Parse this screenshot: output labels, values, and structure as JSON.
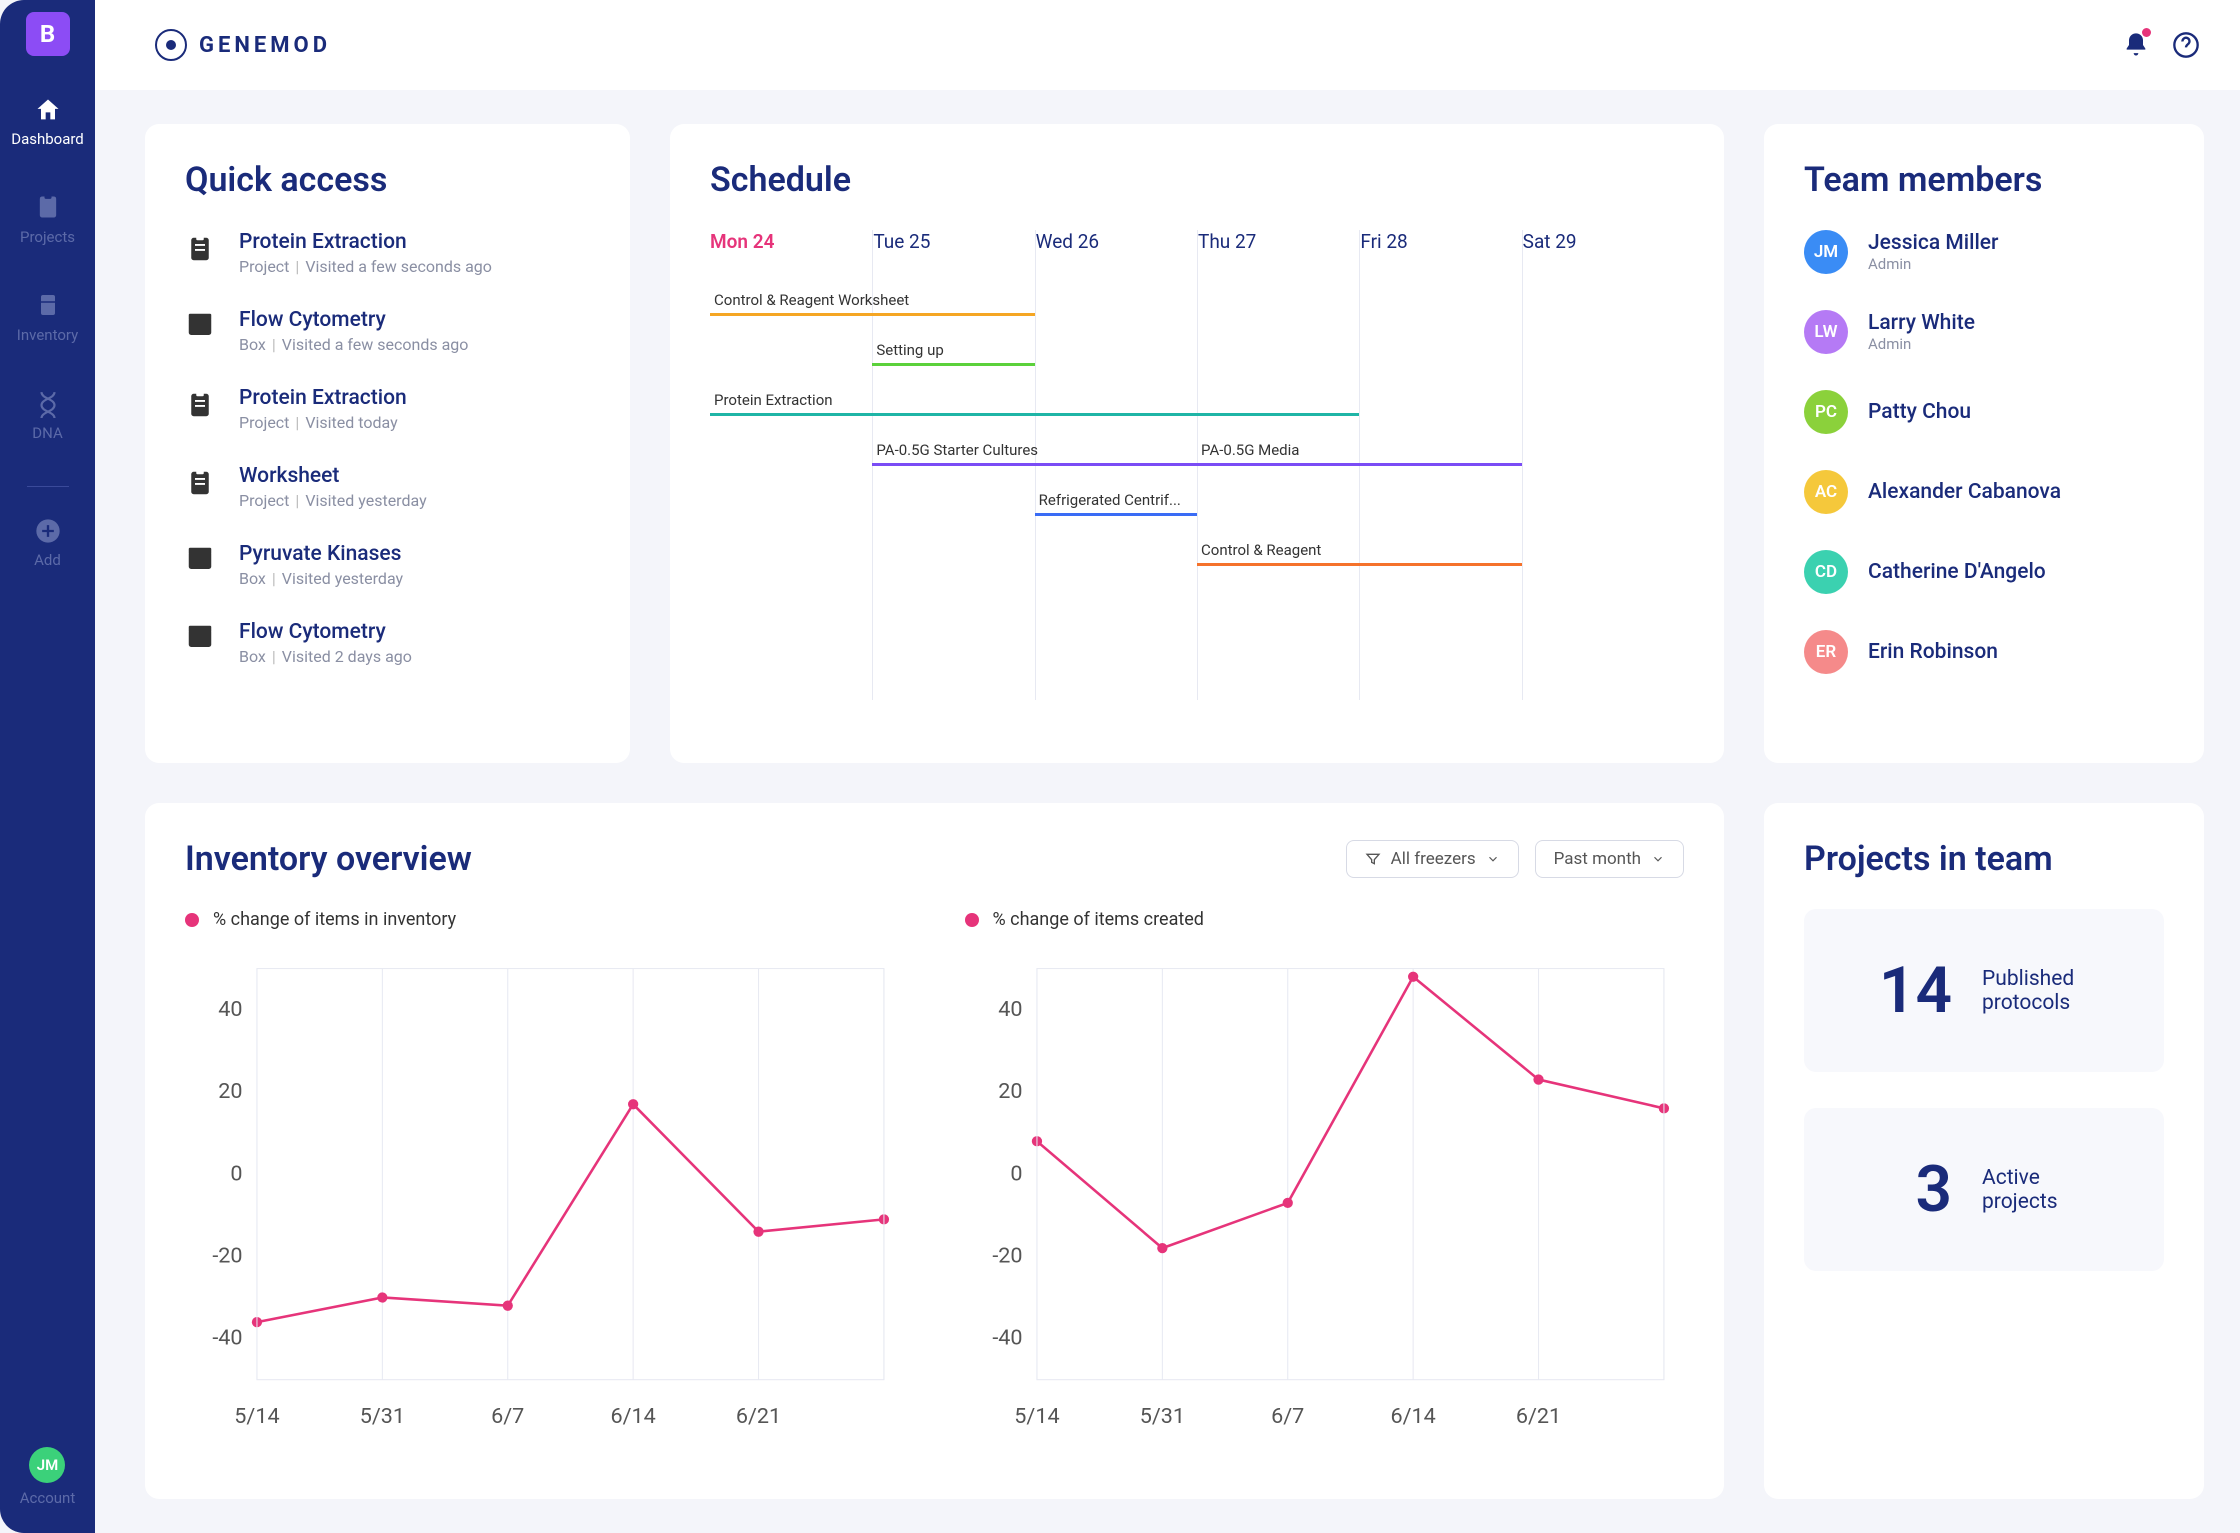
{
  "brand": "GENEMOD",
  "sidebar": {
    "logo": "B",
    "items": [
      {
        "label": "Dashboard",
        "icon": "home"
      },
      {
        "label": "Projects",
        "icon": "clipboard"
      },
      {
        "label": "Inventory",
        "icon": "fridge"
      },
      {
        "label": "DNA",
        "icon": "dna"
      },
      {
        "label": "Add",
        "icon": "plus"
      }
    ],
    "account": {
      "label": "Account",
      "initials": "JM"
    }
  },
  "quick_access": {
    "title": "Quick access",
    "items": [
      {
        "title": "Protein Extraction",
        "type": "Project",
        "visited": "Visited a few seconds ago",
        "icon": "clipboard"
      },
      {
        "title": "Flow Cytometry",
        "type": "Box",
        "visited": "Visited a few seconds ago",
        "icon": "box"
      },
      {
        "title": "Protein Extraction",
        "type": "Project",
        "visited": "Visited today",
        "icon": "clipboard"
      },
      {
        "title": "Worksheet",
        "type": "Project",
        "visited": "Visited yesterday",
        "icon": "clipboard"
      },
      {
        "title": "Pyruvate Kinases",
        "type": "Box",
        "visited": "Visited yesterday",
        "icon": "box"
      },
      {
        "title": "Flow Cytometry",
        "type": "Box",
        "visited": "Visited 2 days ago",
        "icon": "box"
      }
    ]
  },
  "schedule": {
    "title": "Schedule",
    "days": [
      "Mon 24",
      "Tue 25",
      "Wed 26",
      "Thu 27",
      "Fri 28",
      "Sat 29"
    ],
    "active_day_index": 0,
    "bars": [
      {
        "label": "Control & Reagent Worksheet",
        "start": 0,
        "span": 2,
        "color": "#f5a623",
        "row": 0
      },
      {
        "label": "Setting up",
        "start": 1,
        "span": 1,
        "color": "#5bd13b",
        "row": 1
      },
      {
        "label": "Protein Extraction",
        "start": 0,
        "span": 4,
        "color": "#1fb5a6",
        "row": 2
      },
      {
        "label": "PA-0.5G Starter Cultures",
        "start": 1,
        "span": 2,
        "color": "#7a4cf5",
        "row": 3
      },
      {
        "label": "PA-0.5G Media",
        "start": 3,
        "span": 2,
        "color": "#7a4cf5",
        "row": 3
      },
      {
        "label": "Refrigerated Centrif...",
        "start": 2,
        "span": 1,
        "color": "#3a6cf5",
        "row": 4
      },
      {
        "label": "Control & Reagent",
        "start": 3,
        "span": 2,
        "color": "#f5722b",
        "row": 5
      }
    ]
  },
  "team": {
    "title": "Team members",
    "members": [
      {
        "name": "Jessica Miller",
        "role": "Admin",
        "initials": "JM",
        "color": "#3a8cf5"
      },
      {
        "name": "Larry White",
        "role": "Admin",
        "initials": "LW",
        "color": "#b57af5"
      },
      {
        "name": "Patty Chou",
        "role": "",
        "initials": "PC",
        "color": "#8bd13b"
      },
      {
        "name": "Alexander Cabanova",
        "role": "",
        "initials": "AC",
        "color": "#f5c83b"
      },
      {
        "name": "Catherine D'Angelo",
        "role": "",
        "initials": "CD",
        "color": "#3bd1b0"
      },
      {
        "name": "Erin Robinson",
        "role": "",
        "initials": "ER",
        "color": "#f58a8a"
      }
    ]
  },
  "inventory": {
    "title": "Inventory overview",
    "filters": {
      "freezer": "All freezers",
      "range": "Past month"
    },
    "legend1": "% change of items in inventory",
    "legend2": "% change of items created"
  },
  "chart_data": [
    {
      "type": "line",
      "title": "% change of items in inventory",
      "xlabel": "",
      "ylabel": "",
      "categories": [
        "5/14",
        "5/31",
        "6/7",
        "6/14",
        "6/21",
        ""
      ],
      "values": [
        -36,
        -30,
        -32,
        17,
        -14,
        -11
      ],
      "ylim": [
        -50,
        50
      ],
      "color": "#e6347a"
    },
    {
      "type": "line",
      "title": "% change of items created",
      "xlabel": "",
      "ylabel": "",
      "categories": [
        "5/14",
        "5/31",
        "6/7",
        "6/14",
        "6/21",
        ""
      ],
      "values": [
        8,
        -18,
        -7,
        48,
        23,
        16
      ],
      "ylim": [
        -50,
        50
      ],
      "color": "#e6347a"
    }
  ],
  "projects": {
    "title": "Projects in team",
    "stats": [
      {
        "value": "14",
        "label1": "Published",
        "label2": "protocols"
      },
      {
        "value": "3",
        "label1": "Active",
        "label2": "projects"
      }
    ]
  }
}
